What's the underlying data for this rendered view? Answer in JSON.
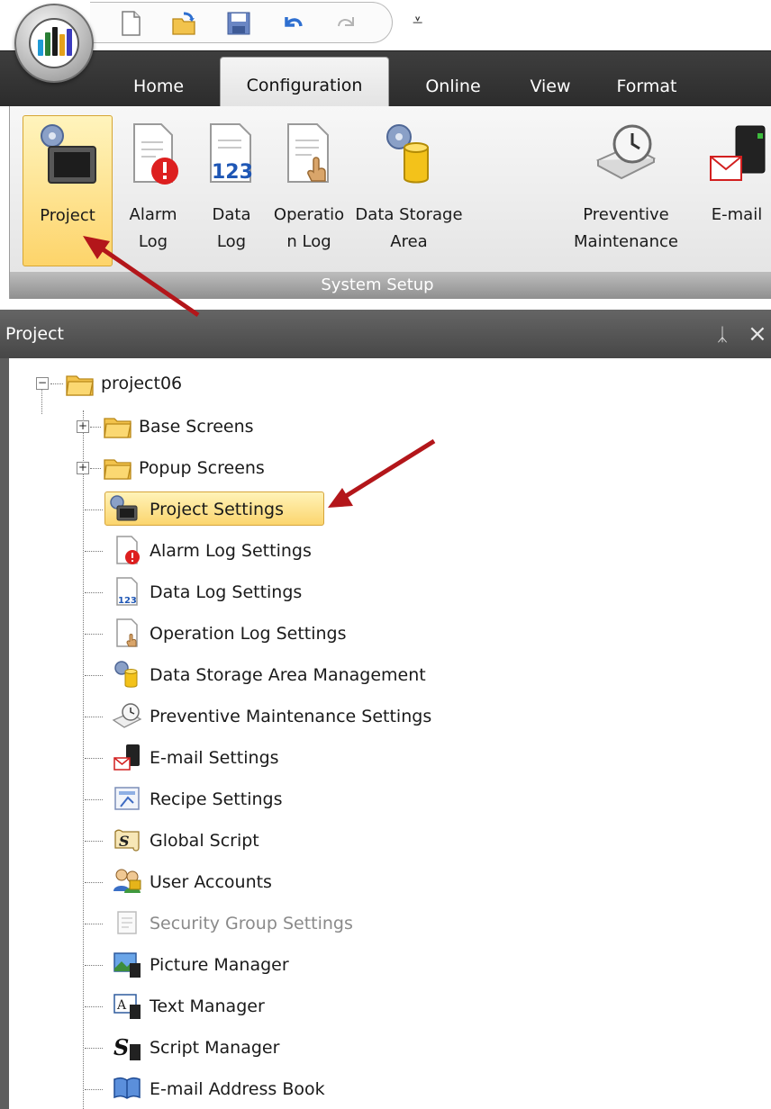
{
  "ribbon_tabs": [
    {
      "label": "Home"
    },
    {
      "label": "Configuration"
    },
    {
      "label": "Online"
    },
    {
      "label": "View"
    },
    {
      "label": "Format"
    }
  ],
  "ribbon": {
    "buttons": [
      {
        "label": "Project",
        "icon": "project-icon"
      },
      {
        "label": "Alarm Log",
        "line1": "Alarm",
        "line2": "Log",
        "icon": "alarm-log-icon"
      },
      {
        "label": "Data Log",
        "line1": "Data",
        "line2": "Log",
        "icon": "data-log-icon",
        "icon_text": "123"
      },
      {
        "label": "Operation Log",
        "line1": "Operatio",
        "line2": "n Log",
        "icon": "operation-log-icon"
      },
      {
        "label": "Data Storage Area",
        "line1": "Data Storage",
        "line2": "Area",
        "icon": "data-storage-icon"
      },
      {
        "label": "Preventive Maintenance",
        "line1": "Preventive",
        "line2": "Maintenance",
        "icon": "maintenance-clock-icon"
      },
      {
        "label": "E-mail",
        "icon": "email-icon"
      }
    ],
    "group_label": "System Setup"
  },
  "project_pane": {
    "title": "Project",
    "pin_glyph": "ᛣ",
    "close_glyph": "×",
    "root": {
      "label": "project06",
      "expander": "−"
    },
    "items": [
      {
        "label": "Base Screens",
        "expander": "+",
        "icon": "folder-icon"
      },
      {
        "label": "Popup Screens",
        "expander": "+",
        "icon": "folder-icon"
      },
      {
        "label": "Project Settings",
        "icon": "project-settings-icon",
        "selected": true
      },
      {
        "label": "Alarm Log Settings",
        "icon": "alarm-log-icon"
      },
      {
        "label": "Data Log Settings",
        "icon": "data-log-icon",
        "icon_text": "123"
      },
      {
        "label": "Operation Log Settings",
        "icon": "operation-log-icon"
      },
      {
        "label": "Data Storage Area Management",
        "icon": "data-storage-icon"
      },
      {
        "label": "Preventive Maintenance Settings",
        "icon": "maintenance-clock-icon"
      },
      {
        "label": "E-mail Settings",
        "icon": "email-icon"
      },
      {
        "label": "Recipe Settings",
        "icon": "recipe-icon"
      },
      {
        "label": "Global Script",
        "icon": "global-script-icon",
        "icon_text": "S"
      },
      {
        "label": "User Accounts",
        "icon": "user-accounts-icon"
      },
      {
        "label": "Security Group Settings",
        "icon": "security-group-icon",
        "disabled": true
      },
      {
        "label": "Picture Manager",
        "icon": "picture-manager-icon"
      },
      {
        "label": "Text Manager",
        "icon": "text-manager-icon",
        "icon_text": "A"
      },
      {
        "label": "Script Manager",
        "icon": "script-manager-icon",
        "icon_text": "S"
      },
      {
        "label": "E-mail Address Book",
        "icon": "address-book-icon"
      }
    ]
  },
  "colors": {
    "annotation_arrow": "#b3161a",
    "selection_fill": "#fbd56e",
    "tab_strip": "#353535",
    "folder": "#f2c34c"
  }
}
